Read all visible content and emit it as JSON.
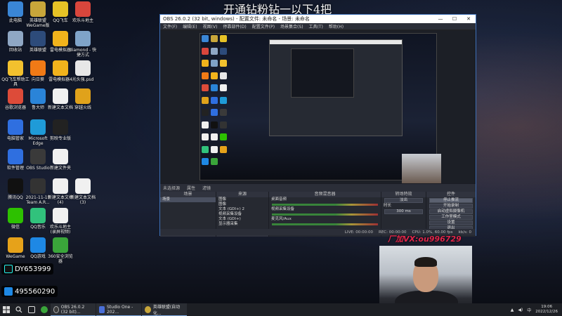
{
  "overlay_title": "开通钻粉钻一以下4把",
  "desktop_icons": [
    {
      "label": "此电脑",
      "color": "#3a86d6"
    },
    {
      "label": "英雄联盟WeGame版",
      "color": "#c8a63a"
    },
    {
      "label": "QQ飞车",
      "color": "#e6c226"
    },
    {
      "label": "欢乐斗地主",
      "color": "#d9463c"
    },
    {
      "label": "回收站",
      "color": "#8fa7c4"
    },
    {
      "label": "英雄联盟",
      "color": "#2d4b7a"
    },
    {
      "label": "雷电模拟器",
      "color": "#f1b31c"
    },
    {
      "label": "diamond - 快捷方式",
      "color": "#7fa3c8"
    },
    {
      "label": "QQ飞车帮助工具",
      "color": "#f2c12e"
    },
    {
      "label": "向日葵",
      "color": "#f07a16"
    },
    {
      "label": "雷电模拟器4",
      "color": "#f1b31c"
    },
    {
      "label": "光头强.psd",
      "color": "#e7e7e7"
    },
    {
      "label": "谷歌浏览器",
      "color": "#dd4b39"
    },
    {
      "label": "鲁大师",
      "color": "#2a84d8"
    },
    {
      "label": "新建文本文档",
      "color": "#f0f0f0"
    },
    {
      "label": "穿越火线",
      "color": "#e0a21b"
    },
    {
      "label": "电脑管家",
      "color": "#2f6fe0"
    },
    {
      "label": "Microsoft Edge",
      "color": "#1f9bd8"
    },
    {
      "label": "剪映专业版",
      "color": "#222222"
    },
    {
      "label": "",
      "color": "transparent"
    },
    {
      "label": "软件管理",
      "color": "#2f6fe0"
    },
    {
      "label": "OBS Studio",
      "color": "#3a3a3a"
    },
    {
      "label": "新建文件夹",
      "color": "#f0f0f0"
    },
    {
      "label": "",
      "color": "transparent"
    },
    {
      "label": "腾讯QQ",
      "color": "#111111"
    },
    {
      "label": "2021-11-19 Team A.R...",
      "color": "#333333"
    },
    {
      "label": "新建文本文档 (4)",
      "color": "#f0f0f0"
    },
    {
      "label": "新建文本文档 (3)",
      "color": "#f0f0f0"
    },
    {
      "label": "微信",
      "color": "#2dc100"
    },
    {
      "label": "QQ音乐",
      "color": "#31c27c"
    },
    {
      "label": "欢乐斗地主 (录屏视频)",
      "color": "#f0f0f0"
    },
    {
      "label": "",
      "color": "transparent"
    },
    {
      "label": "WeGame",
      "color": "#e6a21a"
    },
    {
      "label": "QQ游戏",
      "color": "#1e88e5"
    },
    {
      "label": "360安全浏览器",
      "color": "#3aa53a"
    },
    {
      "label": "",
      "color": "transparent"
    }
  ],
  "obs": {
    "title": "OBS 26.0.2 (32 bit, windows) - 配置文件: 未命名 - 场景: 未命名",
    "window_controls": [
      "—",
      "☐",
      "✕"
    ],
    "menu": [
      "文件(F)",
      "编辑(E)",
      "视图(V)",
      "停靠部件(D)",
      "配置文件(P)",
      "场景集合(S)",
      "工具(T)",
      "帮助(H)"
    ],
    "scene_strip": {
      "label": "未选择源",
      "gear": "属性",
      "filter": "滤镜"
    },
    "docks": {
      "scenes": {
        "header": "场景",
        "items": [
          "场景"
        ],
        "footer": "+ − ∧ ∨"
      },
      "sources": {
        "header": "来源",
        "items": [
          "图像",
          "图像",
          "文本 (GDI+) 2",
          "视频采集设备",
          "文本 (GDI+)",
          "显示器采集"
        ],
        "footer": "+ − ⚙ ∧ ∨"
      },
      "mixer": {
        "header": "音频混音器",
        "channels": [
          {
            "name": "桌面音频",
            "value": "0.0 dB"
          },
          {
            "name": "视频采集设备",
            "value": "0.0 dB"
          },
          {
            "name": "麦克风/Aux",
            "value": "0.0 dB"
          }
        ]
      },
      "transitions": {
        "header": "转场特效",
        "type": "淡出",
        "duration_label": "时长",
        "duration": "300 ms"
      },
      "controls": {
        "header": "控件",
        "buttons": [
          "停止推流",
          "开始录制",
          "启动虚拟摄像机",
          "工作室模式",
          "设置",
          "退出"
        ]
      }
    },
    "status": [
      "LIVE: 00:00:00",
      "REC: 00:00:00",
      "CPU: 1.0%, 60.00 fps",
      "kb/s: 0"
    ]
  },
  "overlays": {
    "vx_text": "厂加VX:ou996729",
    "douyin_id": "DY653999",
    "qq_id": "495560290"
  },
  "taskbar": {
    "apps": [
      {
        "label": "OBS 26.0.2 (32 bit)...",
        "color": "#3a3a3a"
      },
      {
        "label": "Studio One - 202...",
        "color": "#4a6fd8"
      },
      {
        "label": "英雄联盟(自动化...",
        "color": "#c8a63a"
      }
    ],
    "time": "19:06",
    "date": "2022/12/26",
    "ime": "中"
  }
}
